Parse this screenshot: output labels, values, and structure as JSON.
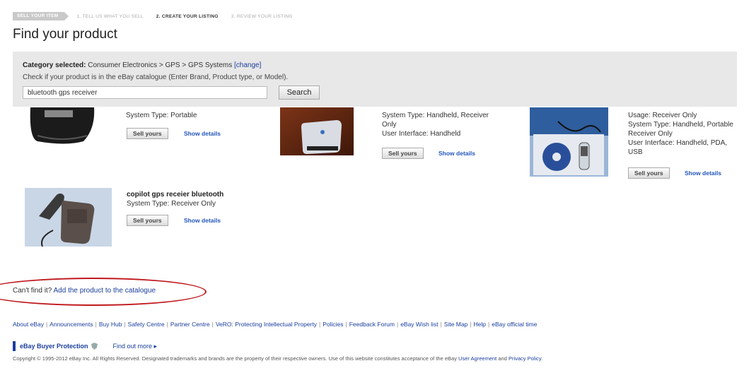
{
  "steps": [
    "SELL YOUR ITEM",
    "1. TELL US WHAT YOU SELL",
    "2. CREATE YOUR LISTING",
    "3. REVIEW YOUR LISTING"
  ],
  "page_title": "Find your product",
  "panel": {
    "category_label": "Category selected:",
    "category_path": "Consumer Electronics > GPS > GPS Systems",
    "change_link": "[change]",
    "hint": "Check if your product is in the eBay catalogue (Enter Brand, Product type, or Model).",
    "search_value": "bluetooth gps receiver",
    "search_button": "Search"
  },
  "results": [
    {
      "lines": [
        "System Type: Portable"
      ]
    },
    {
      "lines": [
        "System Type: Handheld, Receiver",
        "Only",
        "User Interface: Handheld"
      ]
    },
    {
      "lines": [
        "Usage: Receiver Only",
        "System Type: Handheld, Portable",
        "Receiver Only",
        "User Interface: Handheld, PDA,",
        "USB"
      ]
    },
    {
      "title": "copilot gps receier bluetooth",
      "lines": [
        "System Type: Receiver Only"
      ]
    }
  ],
  "sell_label": "Sell yours",
  "details_label": "Show details",
  "cant_find": {
    "text": "Can't find it?",
    "link": "Add the product to the catalogue"
  },
  "footer_links": [
    "About eBay",
    "Announcements",
    "Buy Hub",
    "Safety Centre",
    "Partner Centre",
    "VeRO: Protecting Intellectual Property",
    "Policies",
    "Feedback Forum",
    "eBay Wish list",
    "Site Map",
    "Help",
    "eBay official time"
  ],
  "protection": {
    "label": "eBay Buyer Protection",
    "more": "Find out more ▸"
  },
  "copyright": {
    "text": "Copyright © 1995-2012 eBay Inc. All Rights Reserved. Designated trademarks and brands are the property of their respective owners. Use of this website constitutes acceptance of the eBay",
    "agreement": "User Agreement",
    "and": "and",
    "privacy": "Privacy Policy",
    "end": "."
  },
  "colors": {
    "link": "#1a3e9e",
    "panel": "#e8e8e8",
    "highlight": "#c0191f"
  }
}
